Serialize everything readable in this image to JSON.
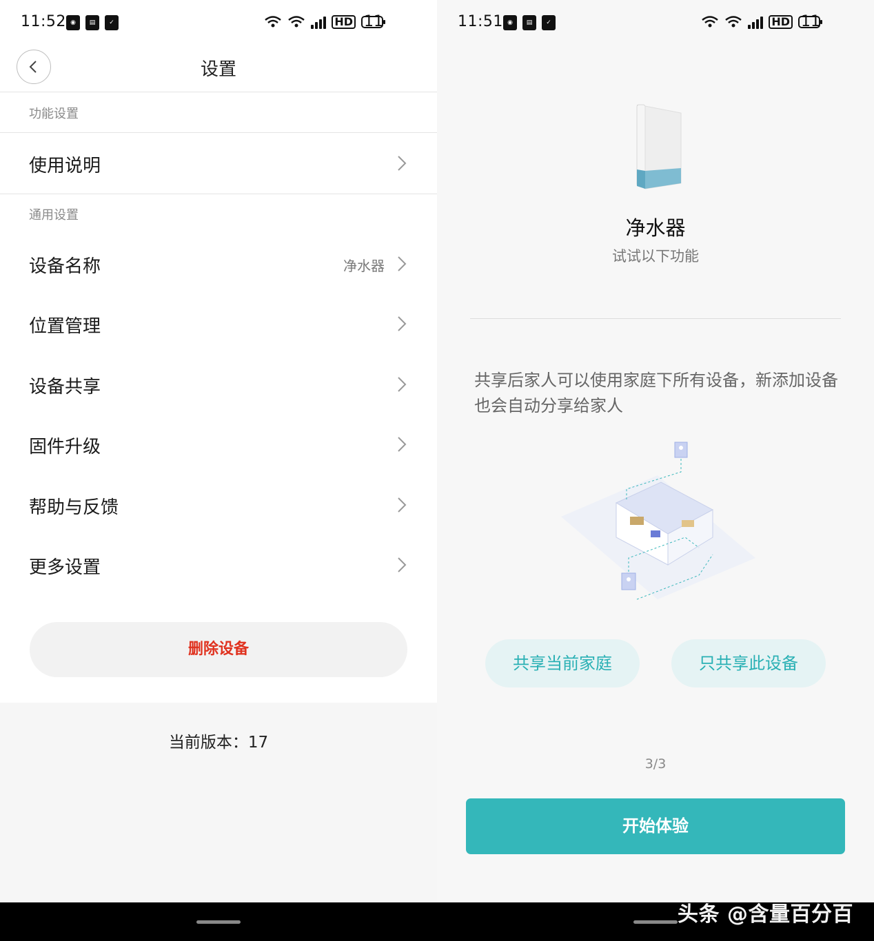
{
  "left": {
    "status": {
      "time": "11:52",
      "battery": "11"
    },
    "header": {
      "title": "设置"
    },
    "sections": [
      {
        "label": "功能设置"
      },
      {
        "label": "通用设置"
      }
    ],
    "rows": [
      {
        "label": "使用说明",
        "value": ""
      },
      {
        "label": "设备名称",
        "value": "净水器"
      },
      {
        "label": "位置管理",
        "value": ""
      },
      {
        "label": "设备共享",
        "value": ""
      },
      {
        "label": "固件升级",
        "value": ""
      },
      {
        "label": "帮助与反馈",
        "value": ""
      },
      {
        "label": "更多设置",
        "value": ""
      }
    ],
    "delete_label": "删除设备",
    "version_text": "当前版本：17"
  },
  "right": {
    "status": {
      "time": "11:51",
      "battery": "11"
    },
    "device_name": "净水器",
    "device_subtitle": "试试以下功能",
    "share_description": "共享后家人可以使用家庭下所有设备，新添加设备也会自动分享给家人",
    "share_home_label": "共享当前家庭",
    "share_device_label": "只共享此设备",
    "pager": "3/3",
    "start_label": "开始体验"
  },
  "watermark": "头条 @含量百分百",
  "colors": {
    "accent": "#34b7ba",
    "pill_bg": "#e5f3f4",
    "delete": "#e0321f"
  }
}
